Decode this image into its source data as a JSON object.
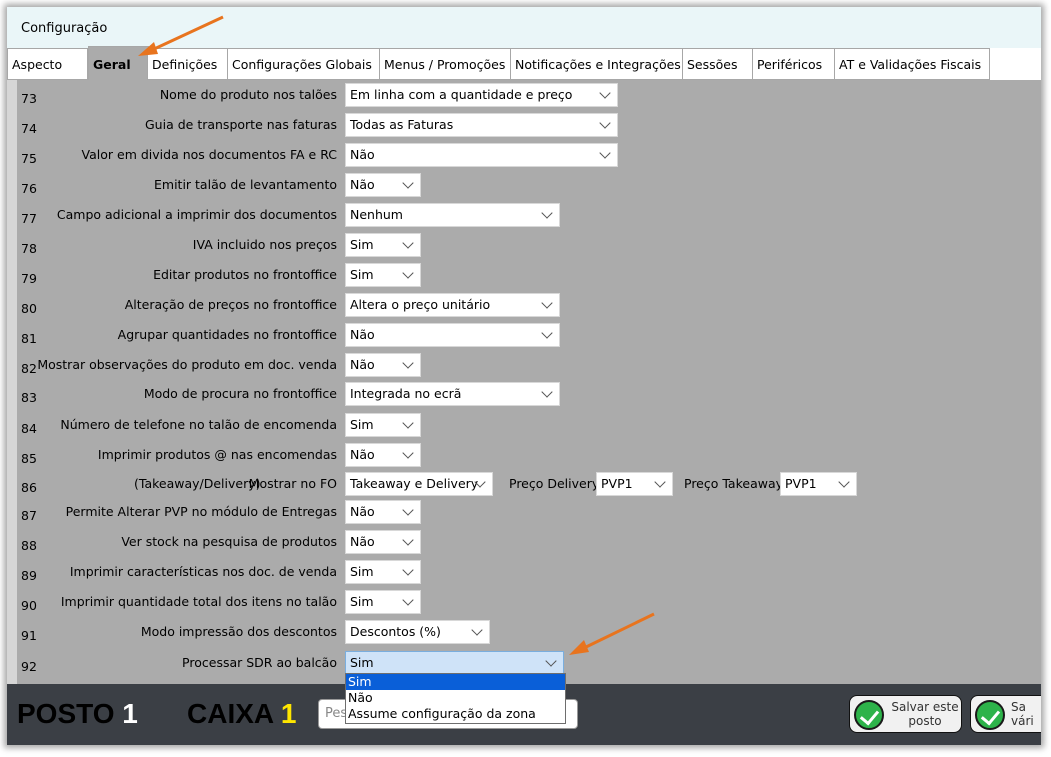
{
  "window": {
    "title": "Configuração"
  },
  "tabs": [
    {
      "label": "Aspecto"
    },
    {
      "label": "Geral"
    },
    {
      "label": "Definições"
    },
    {
      "label": "Configurações Globais"
    },
    {
      "label": "Menus / Promoções"
    },
    {
      "label": "Notificações e Integrações"
    },
    {
      "label": "Sessões"
    },
    {
      "label": "Periféricos"
    },
    {
      "label": "AT e Validações Fiscais"
    }
  ],
  "active_tab": "Geral",
  "settings": [
    {
      "num": "73",
      "label": "Nome do produto nos talões",
      "value": "Em linha com a quantidade e preço"
    },
    {
      "num": "74",
      "label": "Guia de transporte nas faturas",
      "value": "Todas as Faturas"
    },
    {
      "num": "75",
      "label": "Valor em divida nos documentos FA e RC",
      "value": "Não"
    },
    {
      "num": "76",
      "label": "Emitir talão de levantamento",
      "value": "Não"
    },
    {
      "num": "77",
      "label": "Campo adicional a imprimir dos documentos",
      "value": "Nenhum"
    },
    {
      "num": "78",
      "label": "IVA incluido nos preços",
      "value": "Sim"
    },
    {
      "num": "79",
      "label": "Editar produtos no frontoffice",
      "value": "Sim"
    },
    {
      "num": "80",
      "label": "Alteração de preços no frontoffice",
      "value": "Altera o preço unitário"
    },
    {
      "num": "81",
      "label": "Agrupar quantidades no frontoffice",
      "value": "Não"
    },
    {
      "num": "82",
      "label": "Mostrar observações do produto em doc. venda",
      "value": "Não"
    },
    {
      "num": "83",
      "label": "Modo de procura no frontoffice",
      "value": "Integrada no ecrã"
    },
    {
      "num": "84",
      "label": "Número de telefone no talão de encomenda",
      "value": "Sim"
    },
    {
      "num": "85",
      "label": "Imprimir produtos @ nas encomendas",
      "value": "Não"
    },
    {
      "num": "86",
      "label_prefix": "(Takeaway/Delivery)",
      "label": "Mostrar no FO",
      "value": "Takeaway e Delivery",
      "extra": [
        {
          "label": "Preço Delivery",
          "value": "PVP1"
        },
        {
          "label": "Preço Takeaway",
          "value": "PVP1"
        }
      ]
    },
    {
      "num": "87",
      "label": "Permite Alterar PVP no módulo de Entregas",
      "value": "Não"
    },
    {
      "num": "88",
      "label": "Ver stock na pesquisa de produtos",
      "value": "Não"
    },
    {
      "num": "89",
      "label": "Imprimir características nos doc. de venda",
      "value": "Sim"
    },
    {
      "num": "90",
      "label": "Imprimir quantidade total dos itens no talão",
      "value": "Sim"
    },
    {
      "num": "91",
      "label": "Modo impressão dos descontos",
      "value": "Descontos (%)"
    },
    {
      "num": "92",
      "label": "Processar SDR ao balcão",
      "value": "Sim"
    }
  ],
  "dropdown_open": {
    "options": [
      "Sim",
      "Não",
      "Assume configuração da zona"
    ],
    "highlighted": "Sim"
  },
  "bottom": {
    "posto_label": "POSTO",
    "posto_num": "1",
    "caixa_label": "CAIXA",
    "caixa_num": "1",
    "search_placeholder": "Pes",
    "btn_save_posto": "Salvar este posto",
    "btn_save_varios": "Sa vári"
  },
  "colors": {
    "annotation_arrow": "#e8741e",
    "dropdown_highlight": "#0a5fd8"
  }
}
